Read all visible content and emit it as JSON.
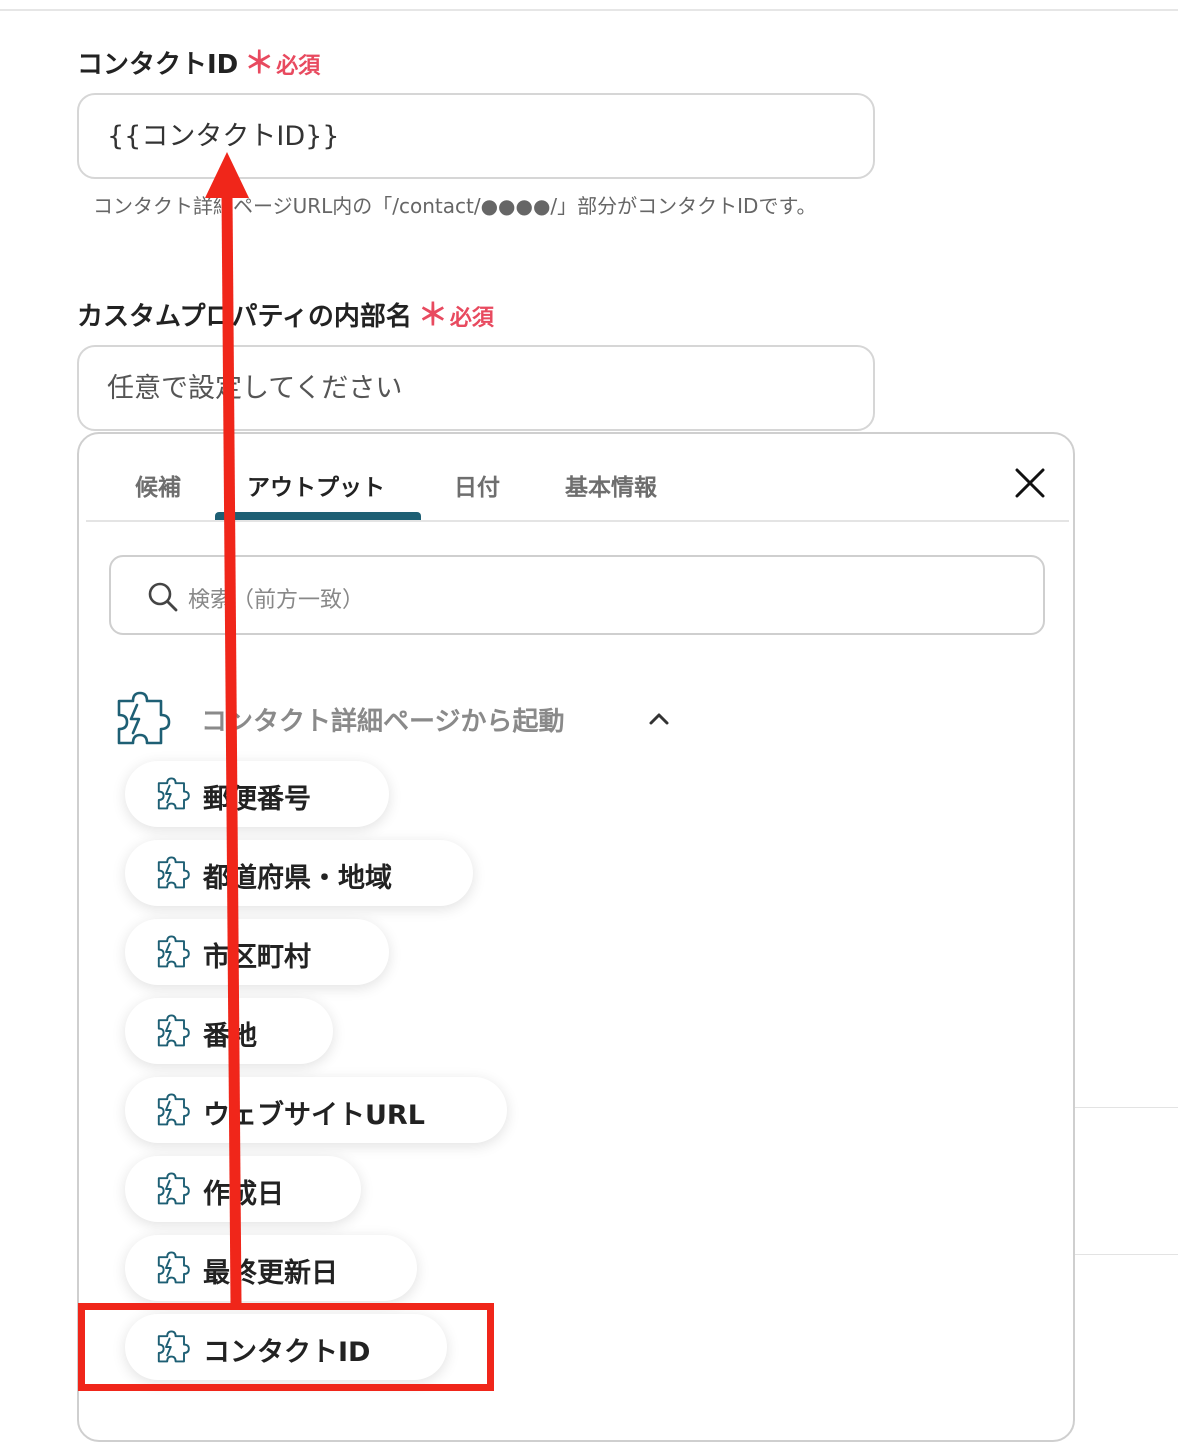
{
  "form": {
    "contact_id": {
      "label": "コンタクトID",
      "required_star": "＊",
      "required_text": "必須",
      "value": "{{コンタクトID}}",
      "hint": "コンタクト詳細ページURL内の「/contact/●●●●/」部分がコンタクトIDです。"
    },
    "custom_property": {
      "label": "カスタムプロパティの内部名",
      "required_star": "＊",
      "required_text": "必須",
      "placeholder": "任意で設定してください"
    }
  },
  "picker": {
    "tabs": [
      "候補",
      "アウトプット",
      "日付",
      "基本情報"
    ],
    "active_tab": "アウトプット",
    "close_icon": "close-icon",
    "search": {
      "placeholder": "検索（前方一致）",
      "icon": "search-icon"
    },
    "group": {
      "label": "コンタクト詳細ページから起動",
      "icon": "puzzle-icon",
      "expanded": true
    },
    "items": [
      "郵便番号",
      "都道府県・地域",
      "市区町村",
      "番地",
      "ウェブサイトURL",
      "作成日",
      "最終更新日",
      "コンタクトID"
    ],
    "highlighted_item": "コンタクトID"
  },
  "colors": {
    "accent": "#1e5f74",
    "required": "#e84a5f",
    "annotation": "#f0261a",
    "icon": "#1e5f74"
  }
}
